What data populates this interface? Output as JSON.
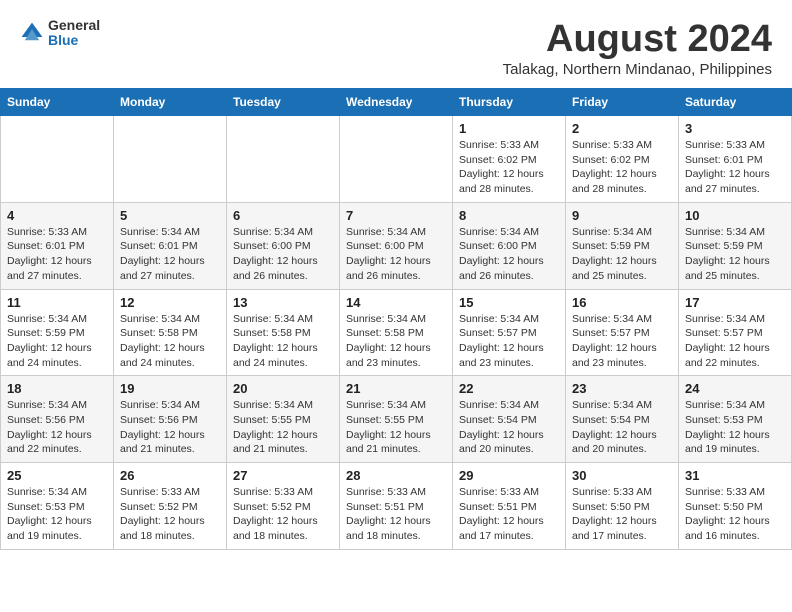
{
  "logo": {
    "general": "General",
    "blue": "Blue"
  },
  "title": {
    "month_year": "August 2024",
    "location": "Talakag, Northern Mindanao, Philippines"
  },
  "days_of_week": [
    "Sunday",
    "Monday",
    "Tuesday",
    "Wednesday",
    "Thursday",
    "Friday",
    "Saturday"
  ],
  "weeks": [
    [
      {
        "date": "",
        "info": ""
      },
      {
        "date": "",
        "info": ""
      },
      {
        "date": "",
        "info": ""
      },
      {
        "date": "",
        "info": ""
      },
      {
        "date": "1",
        "info": "Sunrise: 5:33 AM\nSunset: 6:02 PM\nDaylight: 12 hours\nand 28 minutes."
      },
      {
        "date": "2",
        "info": "Sunrise: 5:33 AM\nSunset: 6:02 PM\nDaylight: 12 hours\nand 28 minutes."
      },
      {
        "date": "3",
        "info": "Sunrise: 5:33 AM\nSunset: 6:01 PM\nDaylight: 12 hours\nand 27 minutes."
      }
    ],
    [
      {
        "date": "4",
        "info": "Sunrise: 5:33 AM\nSunset: 6:01 PM\nDaylight: 12 hours\nand 27 minutes."
      },
      {
        "date": "5",
        "info": "Sunrise: 5:34 AM\nSunset: 6:01 PM\nDaylight: 12 hours\nand 27 minutes."
      },
      {
        "date": "6",
        "info": "Sunrise: 5:34 AM\nSunset: 6:00 PM\nDaylight: 12 hours\nand 26 minutes."
      },
      {
        "date": "7",
        "info": "Sunrise: 5:34 AM\nSunset: 6:00 PM\nDaylight: 12 hours\nand 26 minutes."
      },
      {
        "date": "8",
        "info": "Sunrise: 5:34 AM\nSunset: 6:00 PM\nDaylight: 12 hours\nand 26 minutes."
      },
      {
        "date": "9",
        "info": "Sunrise: 5:34 AM\nSunset: 5:59 PM\nDaylight: 12 hours\nand 25 minutes."
      },
      {
        "date": "10",
        "info": "Sunrise: 5:34 AM\nSunset: 5:59 PM\nDaylight: 12 hours\nand 25 minutes."
      }
    ],
    [
      {
        "date": "11",
        "info": "Sunrise: 5:34 AM\nSunset: 5:59 PM\nDaylight: 12 hours\nand 24 minutes."
      },
      {
        "date": "12",
        "info": "Sunrise: 5:34 AM\nSunset: 5:58 PM\nDaylight: 12 hours\nand 24 minutes."
      },
      {
        "date": "13",
        "info": "Sunrise: 5:34 AM\nSunset: 5:58 PM\nDaylight: 12 hours\nand 24 minutes."
      },
      {
        "date": "14",
        "info": "Sunrise: 5:34 AM\nSunset: 5:58 PM\nDaylight: 12 hours\nand 23 minutes."
      },
      {
        "date": "15",
        "info": "Sunrise: 5:34 AM\nSunset: 5:57 PM\nDaylight: 12 hours\nand 23 minutes."
      },
      {
        "date": "16",
        "info": "Sunrise: 5:34 AM\nSunset: 5:57 PM\nDaylight: 12 hours\nand 23 minutes."
      },
      {
        "date": "17",
        "info": "Sunrise: 5:34 AM\nSunset: 5:57 PM\nDaylight: 12 hours\nand 22 minutes."
      }
    ],
    [
      {
        "date": "18",
        "info": "Sunrise: 5:34 AM\nSunset: 5:56 PM\nDaylight: 12 hours\nand 22 minutes."
      },
      {
        "date": "19",
        "info": "Sunrise: 5:34 AM\nSunset: 5:56 PM\nDaylight: 12 hours\nand 21 minutes."
      },
      {
        "date": "20",
        "info": "Sunrise: 5:34 AM\nSunset: 5:55 PM\nDaylight: 12 hours\nand 21 minutes."
      },
      {
        "date": "21",
        "info": "Sunrise: 5:34 AM\nSunset: 5:55 PM\nDaylight: 12 hours\nand 21 minutes."
      },
      {
        "date": "22",
        "info": "Sunrise: 5:34 AM\nSunset: 5:54 PM\nDaylight: 12 hours\nand 20 minutes."
      },
      {
        "date": "23",
        "info": "Sunrise: 5:34 AM\nSunset: 5:54 PM\nDaylight: 12 hours\nand 20 minutes."
      },
      {
        "date": "24",
        "info": "Sunrise: 5:34 AM\nSunset: 5:53 PM\nDaylight: 12 hours\nand 19 minutes."
      }
    ],
    [
      {
        "date": "25",
        "info": "Sunrise: 5:34 AM\nSunset: 5:53 PM\nDaylight: 12 hours\nand 19 minutes."
      },
      {
        "date": "26",
        "info": "Sunrise: 5:33 AM\nSunset: 5:52 PM\nDaylight: 12 hours\nand 18 minutes."
      },
      {
        "date": "27",
        "info": "Sunrise: 5:33 AM\nSunset: 5:52 PM\nDaylight: 12 hours\nand 18 minutes."
      },
      {
        "date": "28",
        "info": "Sunrise: 5:33 AM\nSunset: 5:51 PM\nDaylight: 12 hours\nand 18 minutes."
      },
      {
        "date": "29",
        "info": "Sunrise: 5:33 AM\nSunset: 5:51 PM\nDaylight: 12 hours\nand 17 minutes."
      },
      {
        "date": "30",
        "info": "Sunrise: 5:33 AM\nSunset: 5:50 PM\nDaylight: 12 hours\nand 17 minutes."
      },
      {
        "date": "31",
        "info": "Sunrise: 5:33 AM\nSunset: 5:50 PM\nDaylight: 12 hours\nand 16 minutes."
      }
    ]
  ]
}
